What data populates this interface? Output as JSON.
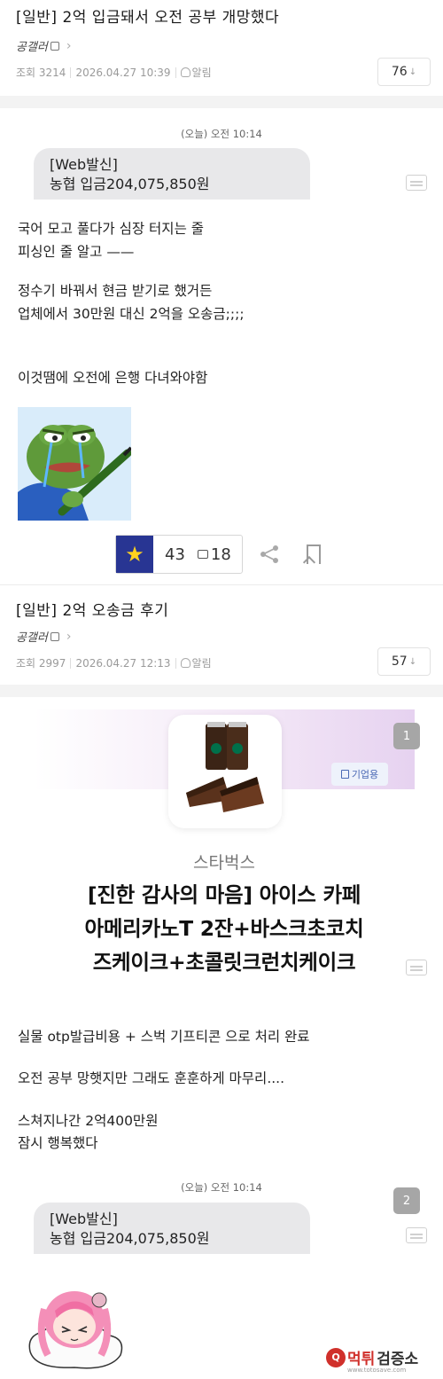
{
  "post1": {
    "title": "[일반] 2억 입금돼서 오전 공부 개망했다",
    "author": "공갤러",
    "views": "조회 3214",
    "datetime": "2026.04.27 10:39",
    "alarm": "알림",
    "comments": "76",
    "sms_time": "(오늘) 오전 10:14",
    "sms_line1": "[Web발신]",
    "sms_line2": "농협 입금204,075,850원",
    "body_lines": [
      "국어 모고 풀다가 심장 터지는 줄",
      "피싱인 줄 알고 ——",
      "정수기 바꿔서 현금 받기로 했거든",
      "업체에서 30만원 대신 2억을 오송금;;;;",
      "이것땜에 오전에 은행 다녀와야함"
    ],
    "likes": "43",
    "comment_count": "18"
  },
  "post2": {
    "title": "[일반] 2억 오송금 후기",
    "author": "공갤러",
    "views": "조회 2997",
    "datetime": "2026.04.27 12:13",
    "alarm": "알림",
    "comments": "57",
    "gift": {
      "corp_label": "기업용",
      "brand": "스타벅스",
      "name_line1": "[진한 감사의 마음] 아이스 카페",
      "name_line2": "아메리카노T 2잔+바스크초코치",
      "name_line3": "즈케이크+초콜릿크런치케이크"
    },
    "page_badge_1": "1",
    "body_lines": [
      "실물 otp발급비용 + 스벅 기프티콘 으로 처리 완료",
      "오전 공부 망햇지만 그래도 훈훈하게 마무리....",
      "스쳐지나간 2억400만원",
      "잠시 행복했다"
    ],
    "sms_time": "(오늘) 오전 10:14",
    "sms_line1": "[Web발신]",
    "sms_line2": "농협 입금204,075,850원",
    "page_badge_2": "2"
  },
  "watermark": {
    "text1": "먹튀",
    "text2": "검증소",
    "sub": "www.totosave.com"
  },
  "colors": {
    "star_bg": "#283593",
    "star": "#ffd21f",
    "watermark_red": "#d0302b"
  }
}
